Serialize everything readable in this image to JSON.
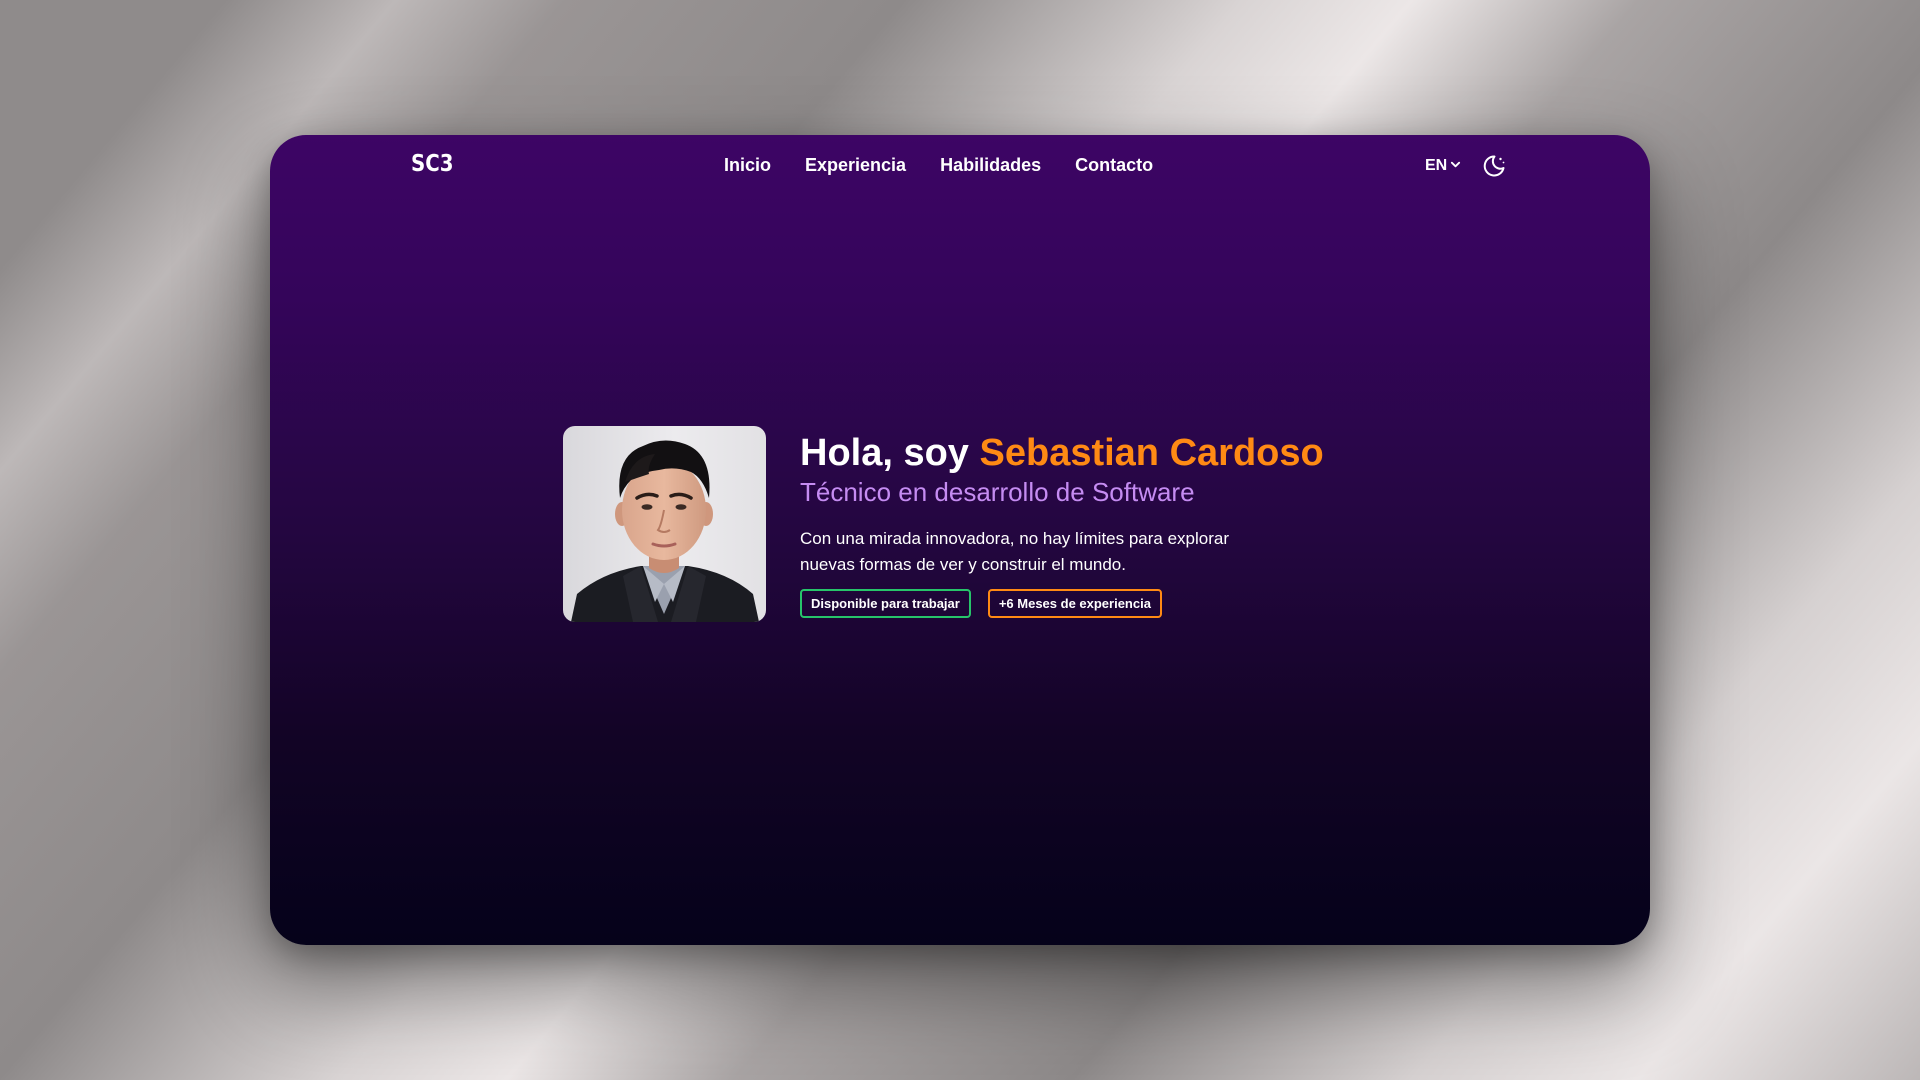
{
  "header": {
    "logo": "SC3",
    "nav": [
      {
        "label": "Inicio"
      },
      {
        "label": "Experiencia"
      },
      {
        "label": "Habilidades"
      },
      {
        "label": "Contacto"
      }
    ],
    "language": "EN",
    "theme_icon": "moon-icon"
  },
  "hero": {
    "greeting": "Hola, soy ",
    "name": "Sebastian Cardoso",
    "title": "Técnico en desarrollo de Software",
    "description": "Con una mirada innovadora, no hay límites para explorar nuevas formas de ver y construir el mundo.",
    "badges": [
      {
        "label": "Disponible para trabajar",
        "color": "#27c46a"
      },
      {
        "label": "+6 Meses de experiencia",
        "color": "#ff8a14"
      }
    ]
  },
  "colors": {
    "accent_orange": "#ff8a14",
    "subtitle_purple": "#c58cf2",
    "bg_top": "#3d0565",
    "bg_bottom": "#05021a"
  }
}
